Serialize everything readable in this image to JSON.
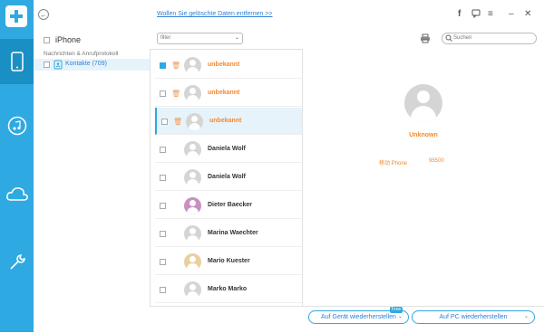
{
  "header": {
    "hint_link": "Wollen Sie gelöschte Daten entfernen >>",
    "icons": [
      "back-icon",
      "facebook-icon",
      "feedback-icon",
      "menu-icon",
      "minimize-icon",
      "close-icon"
    ]
  },
  "rail": {
    "items": [
      "phone-icon",
      "music-icon",
      "cloud-icon",
      "tools-icon"
    ],
    "active": "phone-icon"
  },
  "tree": {
    "device": "iPhone",
    "category": "Nachrichten & Anrufprotokoll",
    "item_label": "Kontakte (709)"
  },
  "toolbar": {
    "filter_placeholder": "filter",
    "search_placeholder": "Suchen"
  },
  "contacts": [
    {
      "name": "unbekannt",
      "unknown": true,
      "checked": true,
      "trash": true,
      "avatar": "default"
    },
    {
      "name": "unbekannt",
      "unknown": true,
      "checked": false,
      "trash": true,
      "avatar": "default"
    },
    {
      "name": "unbekannt",
      "unknown": true,
      "checked": false,
      "trash": true,
      "avatar": "default",
      "selected": true
    },
    {
      "name": "Daniela Wolf",
      "unknown": false,
      "checked": false,
      "avatar": "default"
    },
    {
      "name": "Daniela Wolf",
      "unknown": false,
      "checked": false,
      "avatar": "default"
    },
    {
      "name": "Dieter Baecker",
      "unknown": false,
      "checked": false,
      "avatar": "photo1"
    },
    {
      "name": "Marina Waechter",
      "unknown": false,
      "checked": false,
      "avatar": "default"
    },
    {
      "name": "Mario Kuester",
      "unknown": false,
      "checked": false,
      "avatar": "photo2"
    },
    {
      "name": "Marko Marko",
      "unknown": false,
      "checked": false,
      "avatar": "default"
    }
  ],
  "detail": {
    "name": "Unknown",
    "phone_label": "移动 Phone",
    "phone_value": "95500"
  },
  "footer": {
    "restore_device": "Auf Gerät wiederherstellen",
    "free_badge": "Free",
    "restore_pc": "Auf PC wiederherstellen"
  },
  "colors": {
    "accent": "#2fa9e1",
    "unknown_text": "#f08a30",
    "link": "#2f7fd6"
  }
}
